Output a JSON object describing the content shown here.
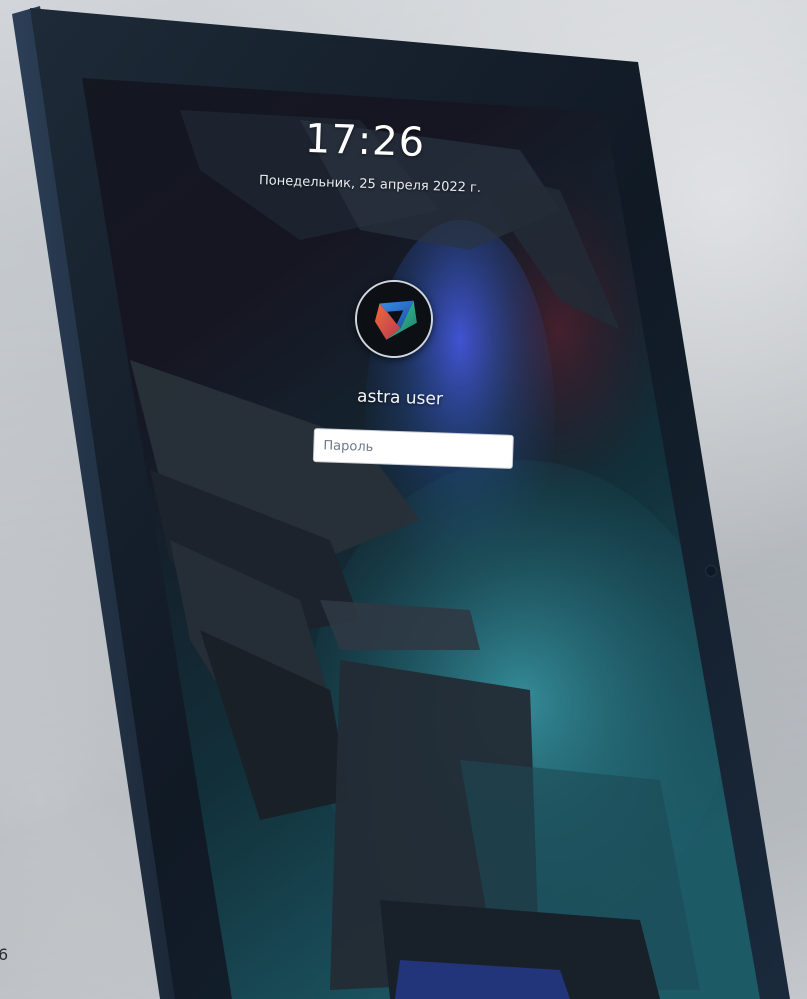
{
  "lock_screen": {
    "time": "17:26",
    "date": "Понедельник, 25 апреля 2022 г.",
    "user": {
      "name": "astra user",
      "avatar_icon": "astra-logo-icon"
    },
    "password": {
      "placeholder": "Пароль",
      "value": ""
    }
  },
  "edge_text": "6",
  "colors": {
    "bezel": "#131c28",
    "screen_dark": "#0b1018",
    "accent_teal": "#2f8f9c",
    "accent_blue": "#3b4fd6"
  }
}
